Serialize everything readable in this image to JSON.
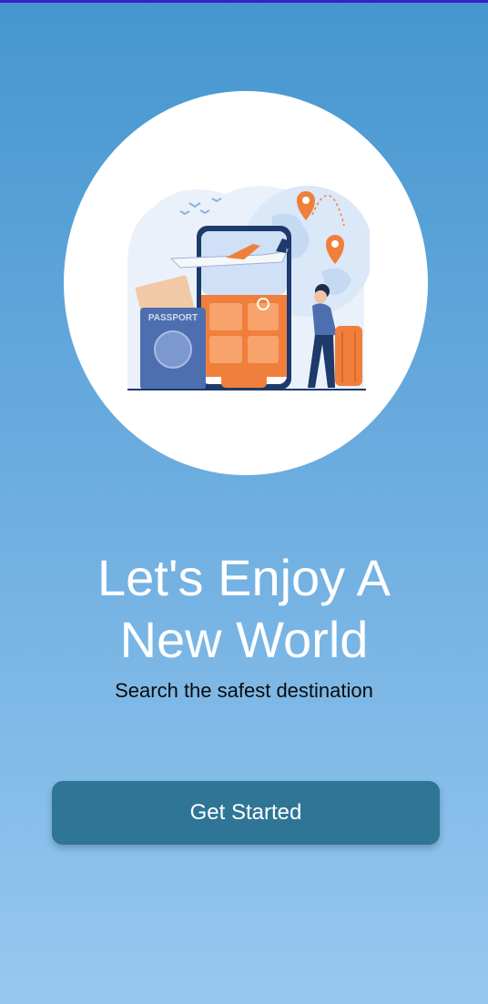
{
  "hero": {
    "illustration_icon": "travel-illustration",
    "passport_text": "PASSPORT"
  },
  "headline": {
    "line1": "Let's Enjoy A",
    "line2": "New World"
  },
  "subtitle": "Search the safest destination",
  "cta": {
    "label": "Get Started"
  },
  "colors": {
    "background_top": "#4596d0",
    "background_bottom": "#97c8f0",
    "button": "#2f7595",
    "accent_orange": "#f07f3c"
  }
}
